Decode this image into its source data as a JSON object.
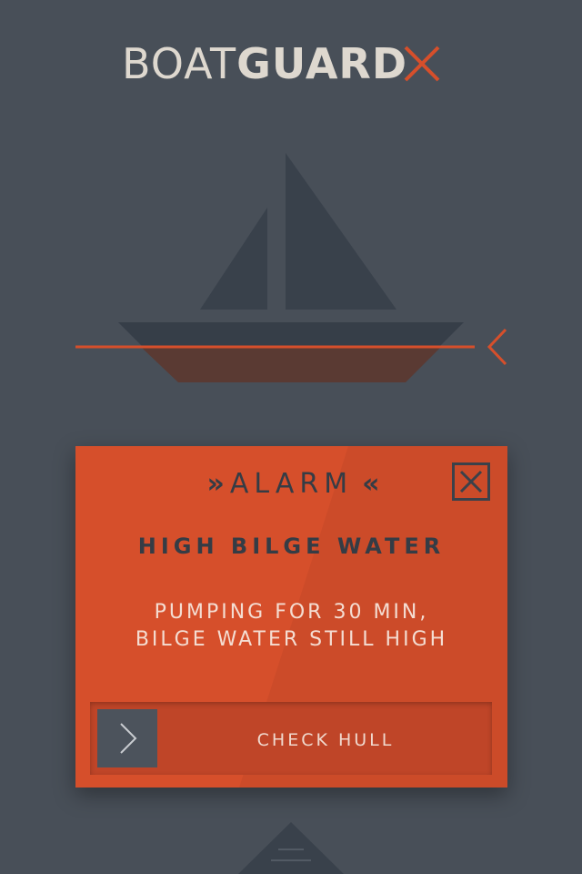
{
  "header": {
    "logo_light": "BOAT",
    "logo_bold": "GUARD",
    "logo_icon": "close-x-icon",
    "accent_color": "#d64f2b"
  },
  "boat_status": {
    "indicator_icon": "chevron-left-icon"
  },
  "alarm": {
    "header_prefix_icon": "»",
    "label": "ALARM",
    "header_suffix_icon": "«",
    "close_icon": "close-icon",
    "title": "HIGH BILGE WATER",
    "message_line1": "PUMPING FOR 30 MIN,",
    "message_line2": "BILGE WATER STILL HIGH",
    "action_icon": "chevron-right-icon",
    "action_label": "CHECK HULL"
  },
  "footer": {
    "menu_icon": "menu-tab-icon"
  },
  "colors": {
    "background": "#484f58",
    "card": "#d64f2b",
    "dark": "#353c45",
    "logo_text": "#ded8cf"
  }
}
